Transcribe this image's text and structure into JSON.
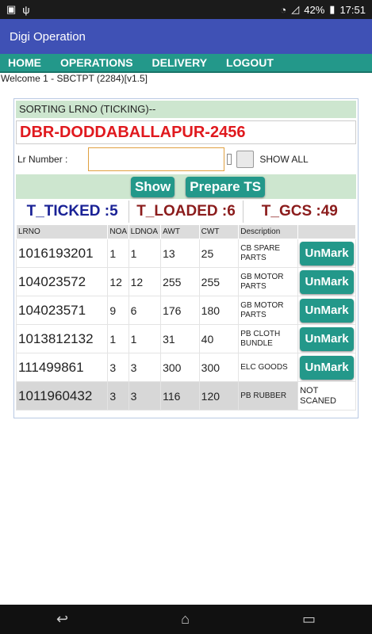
{
  "status": {
    "battery": "42%",
    "time": "17:51"
  },
  "app": {
    "title": "Digi Operation"
  },
  "nav": [
    "HOME",
    "OPERATIONS",
    "DELIVERY",
    "LOGOUT"
  ],
  "welcome": "Welcome 1 - SBCTPT (2284)[v1.5]",
  "panel": {
    "title": "SORTING LRNO (TICKING)--",
    "route": "DBR-DODDABALLAPUR-2456",
    "lr_label": "Lr Number :",
    "lr_value": "",
    "show_all": "SHOW ALL",
    "show_button": "Show",
    "prepare_button": "Prepare TS"
  },
  "stats": {
    "ticked": "T_TICKED :5",
    "loaded": "T_LOADED :6",
    "gcs": "T_GCS :49"
  },
  "table": {
    "headers": [
      "LRNO",
      "NOA",
      "LDNOA",
      "AWT",
      "CWT",
      "Description",
      ""
    ],
    "rows": [
      {
        "lrno": "1016193201",
        "noa": "1",
        "ldnoa": "1",
        "awt": "13",
        "cwt": "25",
        "desc": "CB SPARE PARTS",
        "action": "UnMark"
      },
      {
        "lrno": "104023572",
        "noa": "12",
        "ldnoa": "12",
        "awt": "255",
        "cwt": "255",
        "desc": "GB MOTOR PARTS",
        "action": "UnMark"
      },
      {
        "lrno": "104023571",
        "noa": "9",
        "ldnoa": "6",
        "awt": "176",
        "cwt": "180",
        "desc": "GB MOTOR PARTS",
        "action": "UnMark"
      },
      {
        "lrno": "1013812132",
        "noa": "1",
        "ldnoa": "1",
        "awt": "31",
        "cwt": "40",
        "desc": "PB CLOTH BUNDLE",
        "action": "UnMark"
      },
      {
        "lrno": "111499861",
        "noa": "3",
        "ldnoa": "3",
        "awt": "300",
        "cwt": "300",
        "desc": "ELC GOODS",
        "action": "UnMark"
      },
      {
        "lrno": "1011960432",
        "noa": "3",
        "ldnoa": "3",
        "awt": "116",
        "cwt": "120",
        "desc": "PB RUBBER",
        "status": "NOT SCANED"
      }
    ]
  }
}
